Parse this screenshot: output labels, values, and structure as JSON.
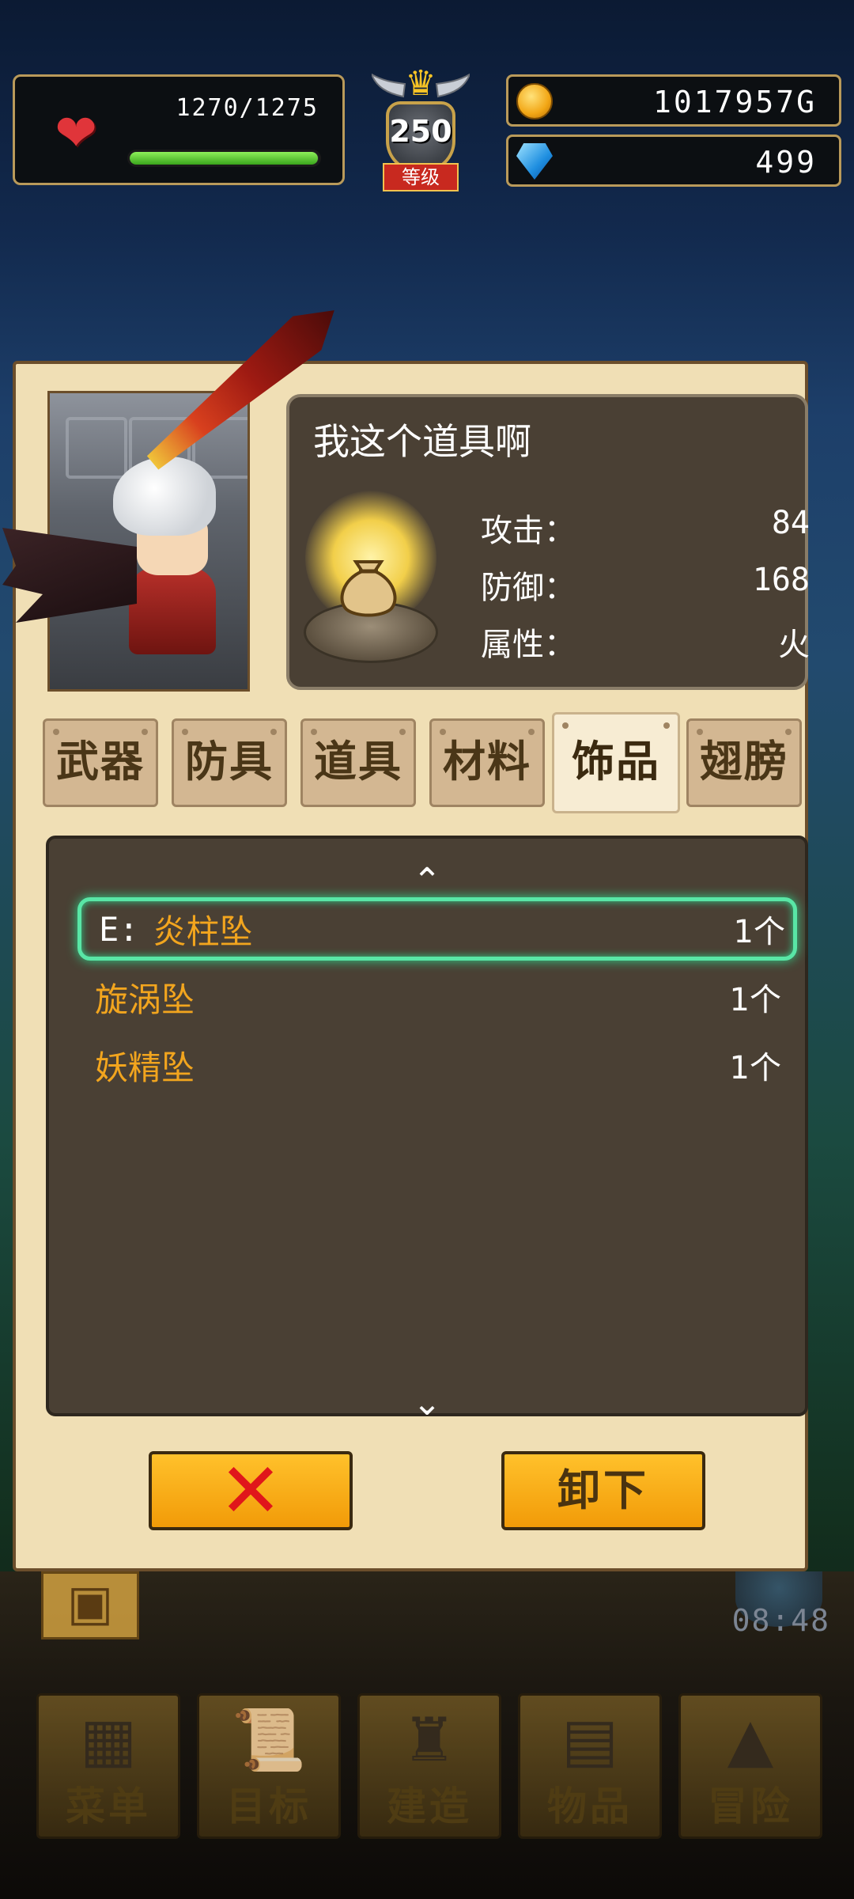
{
  "hud": {
    "hp_text": "1270/1275",
    "hp_fraction": 0.996,
    "level": "250",
    "level_label": "等级",
    "gold": "1017957G",
    "gems": "499"
  },
  "item": {
    "title": "我这个道具啊",
    "stats": [
      {
        "label": "攻击：",
        "value": "84"
      },
      {
        "label": "防御：",
        "value": "168"
      },
      {
        "label": "属性：",
        "value": "火"
      }
    ]
  },
  "tabs": [
    {
      "label": "武器",
      "active": false
    },
    {
      "label": "防具",
      "active": false
    },
    {
      "label": "道具",
      "active": false
    },
    {
      "label": "材料",
      "active": false
    },
    {
      "label": "饰品",
      "active": true
    },
    {
      "label": "翅膀",
      "active": false
    }
  ],
  "list": {
    "items": [
      {
        "prefix": "E:",
        "name": "炎柱坠",
        "count": "1个",
        "selected": true
      },
      {
        "prefix": "",
        "name": "旋涡坠",
        "count": "1个",
        "selected": false
      },
      {
        "prefix": "",
        "name": "妖精坠",
        "count": "1个",
        "selected": false
      }
    ]
  },
  "buttons": {
    "close_symbol": "✕",
    "unequip_label": "卸下"
  },
  "timer": "08:48",
  "nav": [
    {
      "label": "菜单",
      "icon": "grid-icon"
    },
    {
      "label": "目标",
      "icon": "quest-scroll-icon"
    },
    {
      "label": "建造",
      "icon": "castle-icon"
    },
    {
      "label": "物品",
      "icon": "chest-icon"
    },
    {
      "label": "冒险",
      "icon": "mountain-icon"
    }
  ],
  "colors": {
    "hp_green": "#5cc82a",
    "selection_glow": "#59e6a6",
    "item_name_orange": "#f2a51e",
    "button_orange": "#f7a912"
  }
}
